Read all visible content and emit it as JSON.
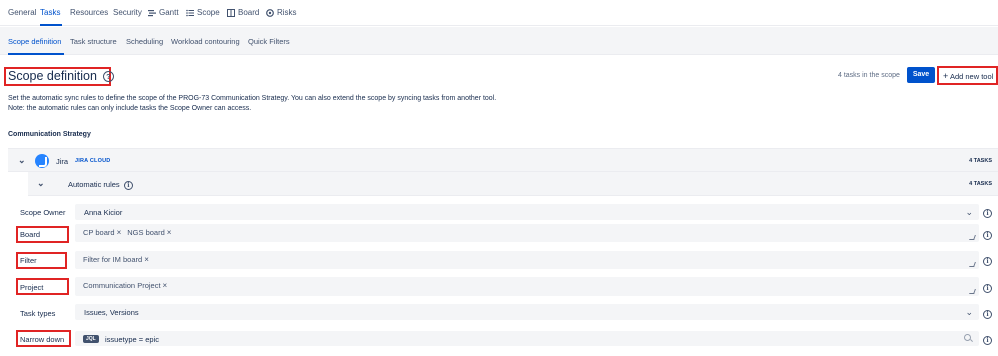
{
  "top_tabs": [
    {
      "label": "General"
    },
    {
      "label": "Tasks"
    },
    {
      "label": "Resources"
    },
    {
      "label": "Security"
    },
    {
      "label": "Gantt",
      "icon": "gantt-icon"
    },
    {
      "label": "Scope",
      "icon": "list-icon"
    },
    {
      "label": "Board",
      "icon": "board-icon"
    },
    {
      "label": "Risks",
      "icon": "risks-icon"
    }
  ],
  "sub_tabs": [
    {
      "label": "Scope definition"
    },
    {
      "label": "Task structure"
    },
    {
      "label": "Scheduling"
    },
    {
      "label": "Workload contouring"
    },
    {
      "label": "Quick Filters"
    }
  ],
  "page": {
    "title": "Scope definition",
    "tasks_in_scope": "4 tasks in the scope",
    "save_label": "Save",
    "add_tool_label": "Add new tool",
    "description": "Set the automatic sync rules to define the scope of the PROG-73 Communication Strategy. You can also extend the scope by syncing tasks from another tool. Note: the automatic rules can only include tasks the Scope Owner can access."
  },
  "section": {
    "title": "Communication Strategy",
    "tool": {
      "name": "Jira",
      "badge": "JIRA CLOUD",
      "count": "4 TASKS"
    },
    "rules": {
      "label": "Automatic rules",
      "count": "4 TASKS"
    }
  },
  "form": {
    "scope_owner": {
      "label": "Scope Owner",
      "value": "Anna Kicior"
    },
    "board": {
      "label": "Board",
      "chips": [
        "CP board",
        "NGS board"
      ]
    },
    "filter": {
      "label": "Filter",
      "chips": [
        "Filter for IM board"
      ]
    },
    "project": {
      "label": "Project",
      "chips": [
        "Communication Project"
      ]
    },
    "task_types": {
      "label": "Task types",
      "value": "Issues, Versions"
    },
    "narrow_down": {
      "label": "Narrow down",
      "tag": "JQL",
      "value": "issuetype = epic"
    }
  },
  "colors": {
    "accent": "#0052cc",
    "highlight": "#e02424",
    "panel": "#f4f5f7"
  }
}
